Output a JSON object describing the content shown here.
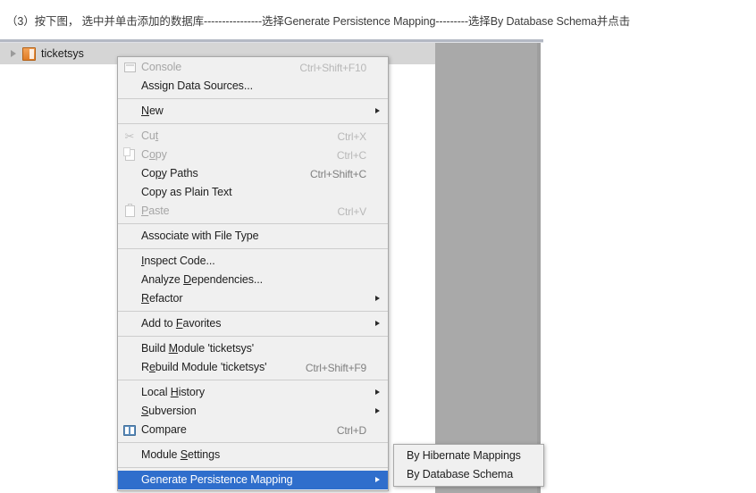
{
  "caption": {
    "full_text": "（3）按下图， 选中并单击添加的数据库----------------选择Generate Persistence Mapping---------选择By Database Schema并点击"
  },
  "tree": {
    "expand_arrow_icon": "triangle-right-icon",
    "module_icon": "module-icon",
    "node_label": "ticketsys"
  },
  "context_menu": {
    "items": [
      {
        "label": "Console",
        "accel": "Ctrl+Shift+F10",
        "icon": "console-icon",
        "disabled": true,
        "submenu": false,
        "selected": false
      },
      {
        "label": "Assign Data Sources...",
        "accel": "",
        "icon": "",
        "disabled": false,
        "submenu": false,
        "selected": false
      },
      {
        "separator": true
      },
      {
        "label": "New",
        "accel": "",
        "icon": "",
        "disabled": false,
        "submenu": true,
        "selected": false
      },
      {
        "separator": true
      },
      {
        "label": "Cut",
        "accel": "Ctrl+X",
        "icon": "cut-icon",
        "disabled": true,
        "submenu": false,
        "selected": false
      },
      {
        "label": "Copy",
        "accel": "Ctrl+C",
        "icon": "copy-icon",
        "disabled": true,
        "submenu": false,
        "selected": false
      },
      {
        "label": "Copy Paths",
        "accel": "Ctrl+Shift+C",
        "icon": "",
        "disabled": false,
        "submenu": false,
        "selected": false
      },
      {
        "label": "Copy as Plain Text",
        "accel": "",
        "icon": "",
        "disabled": false,
        "submenu": false,
        "selected": false
      },
      {
        "label": "Paste",
        "accel": "Ctrl+V",
        "icon": "paste-icon",
        "disabled": true,
        "submenu": false,
        "selected": false
      },
      {
        "separator": true
      },
      {
        "label": "Associate with File Type",
        "accel": "",
        "icon": "",
        "disabled": false,
        "submenu": false,
        "selected": false
      },
      {
        "separator": true
      },
      {
        "label": "Inspect Code...",
        "accel": "",
        "icon": "",
        "disabled": false,
        "submenu": false,
        "selected": false
      },
      {
        "label": "Analyze Dependencies...",
        "accel": "",
        "icon": "",
        "disabled": false,
        "submenu": false,
        "selected": false
      },
      {
        "label": "Refactor",
        "accel": "",
        "icon": "",
        "disabled": false,
        "submenu": true,
        "selected": false
      },
      {
        "separator": true
      },
      {
        "label": "Add to Favorites",
        "accel": "",
        "icon": "",
        "disabled": false,
        "submenu": true,
        "selected": false
      },
      {
        "separator": true
      },
      {
        "label": "Build Module 'ticketsys'",
        "accel": "",
        "icon": "",
        "disabled": false,
        "submenu": false,
        "selected": false
      },
      {
        "label": "Rebuild Module 'ticketsys'",
        "accel": "Ctrl+Shift+F9",
        "icon": "",
        "disabled": false,
        "submenu": false,
        "selected": false
      },
      {
        "separator": true
      },
      {
        "label": "Local History",
        "accel": "",
        "icon": "",
        "disabled": false,
        "submenu": true,
        "selected": false
      },
      {
        "label": "Subversion",
        "accel": "",
        "icon": "",
        "disabled": false,
        "submenu": true,
        "selected": false
      },
      {
        "label": "Compare",
        "accel": "Ctrl+D",
        "icon": "compare-icon",
        "disabled": false,
        "submenu": false,
        "selected": false
      },
      {
        "separator": true
      },
      {
        "label": "Module Settings",
        "accel": "",
        "icon": "",
        "disabled": false,
        "submenu": false,
        "selected": false
      },
      {
        "separator": true
      },
      {
        "label": "Generate Persistence Mapping",
        "accel": "",
        "icon": "",
        "disabled": false,
        "submenu": true,
        "selected": true
      }
    ]
  },
  "submenu": {
    "items": [
      {
        "label": "By Hibernate Mappings",
        "accel": "",
        "icon": "",
        "disabled": false,
        "submenu": false,
        "selected": false
      },
      {
        "label": "By Database Schema",
        "accel": "",
        "icon": "",
        "disabled": false,
        "submenu": false,
        "selected": false
      }
    ]
  },
  "colors": {
    "menu_background": "#f0f0f0",
    "menu_border": "#a8a8a8",
    "highlight": "#2f6ecc",
    "highlight_text": "#ffffff",
    "disabled_text": "#a6a6a6",
    "accel_text": "#808080",
    "tree_selection": "#d5d5d5",
    "editor_panel": "#a9a9a9",
    "caption_text": "#3c3c3c"
  }
}
